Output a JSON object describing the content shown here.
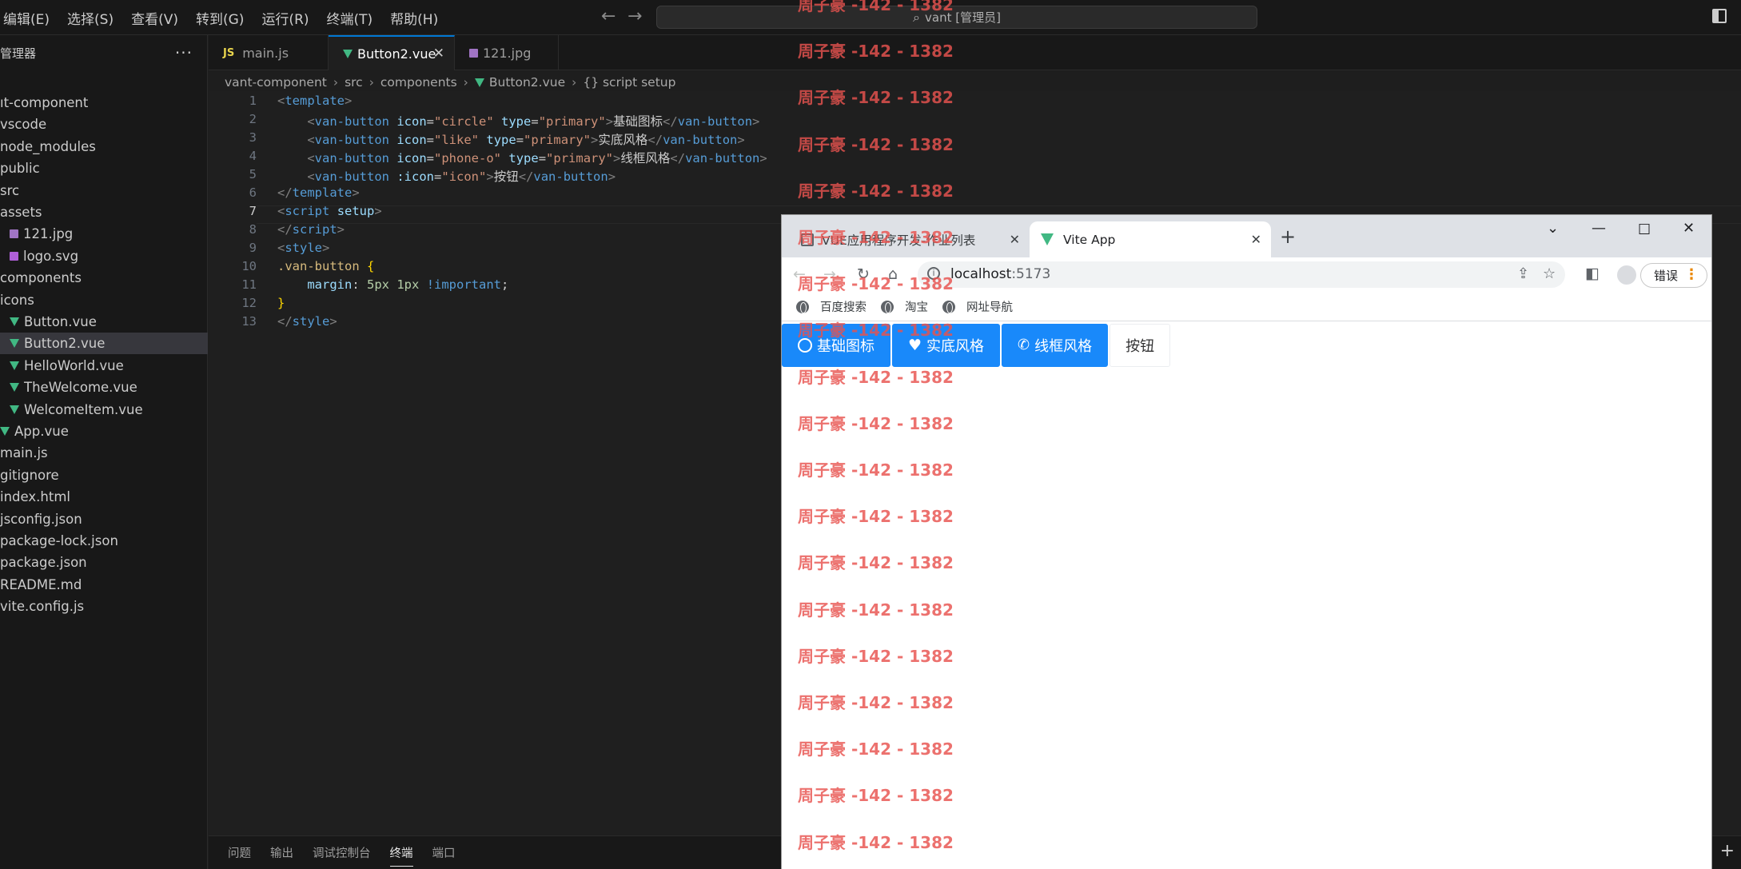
{
  "vscode": {
    "menu": [
      "编辑(E)",
      "选择(S)",
      "查看(V)",
      "转到(G)",
      "运行(R)",
      "终端(T)",
      "帮助(H)"
    ],
    "search": "vant [管理员]",
    "sidebar_title": "管理器",
    "explorer": [
      {
        "label": "ıt-component",
        "kind": "folder"
      },
      {
        "label": "vscode",
        "kind": "folder"
      },
      {
        "label": "node_modules",
        "kind": "folder"
      },
      {
        "label": "public",
        "kind": "folder"
      },
      {
        "label": "src",
        "kind": "folder"
      },
      {
        "label": "assets",
        "kind": "folder"
      },
      {
        "label": "121.jpg",
        "kind": "image"
      },
      {
        "label": "logo.svg",
        "kind": "svg"
      },
      {
        "label": "components",
        "kind": "folder"
      },
      {
        "label": "icons",
        "kind": "folder"
      },
      {
        "label": "Button.vue",
        "kind": "vue"
      },
      {
        "label": "Button2.vue",
        "kind": "vue",
        "selected": true
      },
      {
        "label": "HelloWorld.vue",
        "kind": "vue"
      },
      {
        "label": "TheWelcome.vue",
        "kind": "vue"
      },
      {
        "label": "WelcomeItem.vue",
        "kind": "vue"
      },
      {
        "label": "App.vue",
        "kind": "vue"
      },
      {
        "label": "main.js",
        "kind": "file"
      },
      {
        "label": "gitignore",
        "kind": "file"
      },
      {
        "label": "index.html",
        "kind": "file"
      },
      {
        "label": "jsconfig.json",
        "kind": "file"
      },
      {
        "label": "package-lock.json",
        "kind": "file"
      },
      {
        "label": "package.json",
        "kind": "file"
      },
      {
        "label": "README.md",
        "kind": "file"
      },
      {
        "label": "vite.config.js",
        "kind": "file"
      }
    ],
    "tabs": [
      {
        "label": "main.js",
        "badge": "JS"
      },
      {
        "label": "Button2.vue",
        "active": true
      },
      {
        "label": "121.jpg"
      }
    ],
    "breadcrumb": [
      "vant-component",
      "src",
      "components",
      "Button2.vue",
      "{} script setup"
    ],
    "line_numbers": [
      "1",
      "2",
      "3",
      "4",
      "5",
      "6",
      "7",
      "8",
      "9",
      "10",
      "11",
      "12",
      "13"
    ],
    "current_line": "7",
    "code": {
      "l1_tag": "template",
      "l2_tag": "van-button",
      "l2_a1": "icon",
      "l2_v1": "\"circle\"",
      "l2_a2": "type",
      "l2_v2": "\"primary\"",
      "l2_text": "基础图标",
      "l3_tag": "van-button",
      "l3_a1": "icon",
      "l3_v1": "\"like\"",
      "l3_a2": "type",
      "l3_v2": "\"primary\"",
      "l3_text": "实底风格",
      "l4_tag": "van-button",
      "l4_a1": "icon",
      "l4_v1": "\"phone-o\"",
      "l4_a2": "type",
      "l4_v2": "\"primary\"",
      "l4_text": "线框风格",
      "l5_tag": "van-button",
      "l5_a1": ":icon",
      "l5_v1": "\"icon\"",
      "l5_text": "按钮",
      "l6_tag": "template",
      "l7_tag": "script",
      "l7_attr": "setup",
      "l8_tag": "script",
      "l9_tag": "style",
      "l10_sel": ".van-button",
      "l11_prop": "margin",
      "l11_n1": "5px",
      "l11_n2": "1px",
      "l11_imp": "!important",
      "l13_tag": "style"
    },
    "panel_tabs": [
      "问题",
      "输出",
      "调试控制台",
      "终端",
      "端口"
    ],
    "active_panel": "终端"
  },
  "browser": {
    "tabs": [
      {
        "label": "VUE应用程序开发-作业列表"
      },
      {
        "label": "Vite App",
        "active": true
      }
    ],
    "url_host": "localhost",
    "url_port": ":5173",
    "error_button": "错误",
    "bookmarks": [
      "百度搜索",
      "淘宝",
      "网址导航"
    ],
    "buttons": [
      {
        "label": "基础图标",
        "icon": "circle-icon",
        "type": "primary"
      },
      {
        "label": "实底风格",
        "icon": "like-icon",
        "type": "primary"
      },
      {
        "label": "线框风格",
        "icon": "phone-icon",
        "type": "primary"
      },
      {
        "label": "按钮",
        "type": "default"
      }
    ],
    "primary_color": "#1989fa"
  },
  "watermark": {
    "text": "周子豪 -142 - 1382",
    "color": "#e8534f"
  }
}
